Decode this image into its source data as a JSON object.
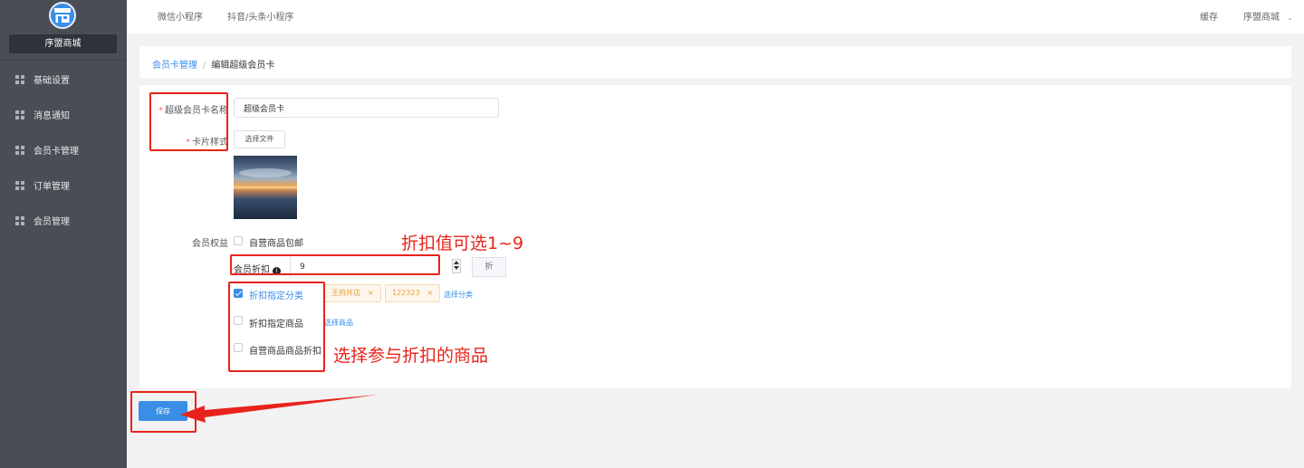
{
  "sidebar": {
    "store_name": "序盟商城",
    "items": [
      {
        "label": "基础设置"
      },
      {
        "label": "消息通知"
      },
      {
        "label": "会员卡管理"
      },
      {
        "label": "订单管理"
      },
      {
        "label": "会员管理"
      }
    ]
  },
  "topbar": {
    "tabs": [
      {
        "label": "微信小程序"
      },
      {
        "label": "抖音/头条小程序"
      }
    ],
    "cache": "缓存",
    "user": "序盟商城"
  },
  "breadcrumb": {
    "parent": "会员卡管理",
    "separator": "/",
    "current": "编辑超级会员卡"
  },
  "form": {
    "name_label": "超级会员卡名称",
    "name_value": "超级会员卡",
    "style_label": "卡片样式",
    "choose_file": "选择文件",
    "benefits_label": "会员权益",
    "free_shipping": "自营商品包邮",
    "discount_label": "会员折扣",
    "discount_value": "9",
    "discount_suffix": "折",
    "opt_category": "折扣指定分类",
    "opt_goods": "折扣指定商品",
    "opt_self": "自营商品商品折扣",
    "tags": [
      {
        "label": "王府井店"
      },
      {
        "label": "122323"
      }
    ],
    "choose_category": "选择分类",
    "choose_goods": "选择商品",
    "save": "保存"
  },
  "annotations": {
    "discount_note": "折扣值可选1~9",
    "goods_note": "选择参与折扣的商品"
  },
  "colors": {
    "accent": "#3a8ee6",
    "annotation_red": "#e8231b",
    "sidebar_bg": "#4a4d55"
  }
}
